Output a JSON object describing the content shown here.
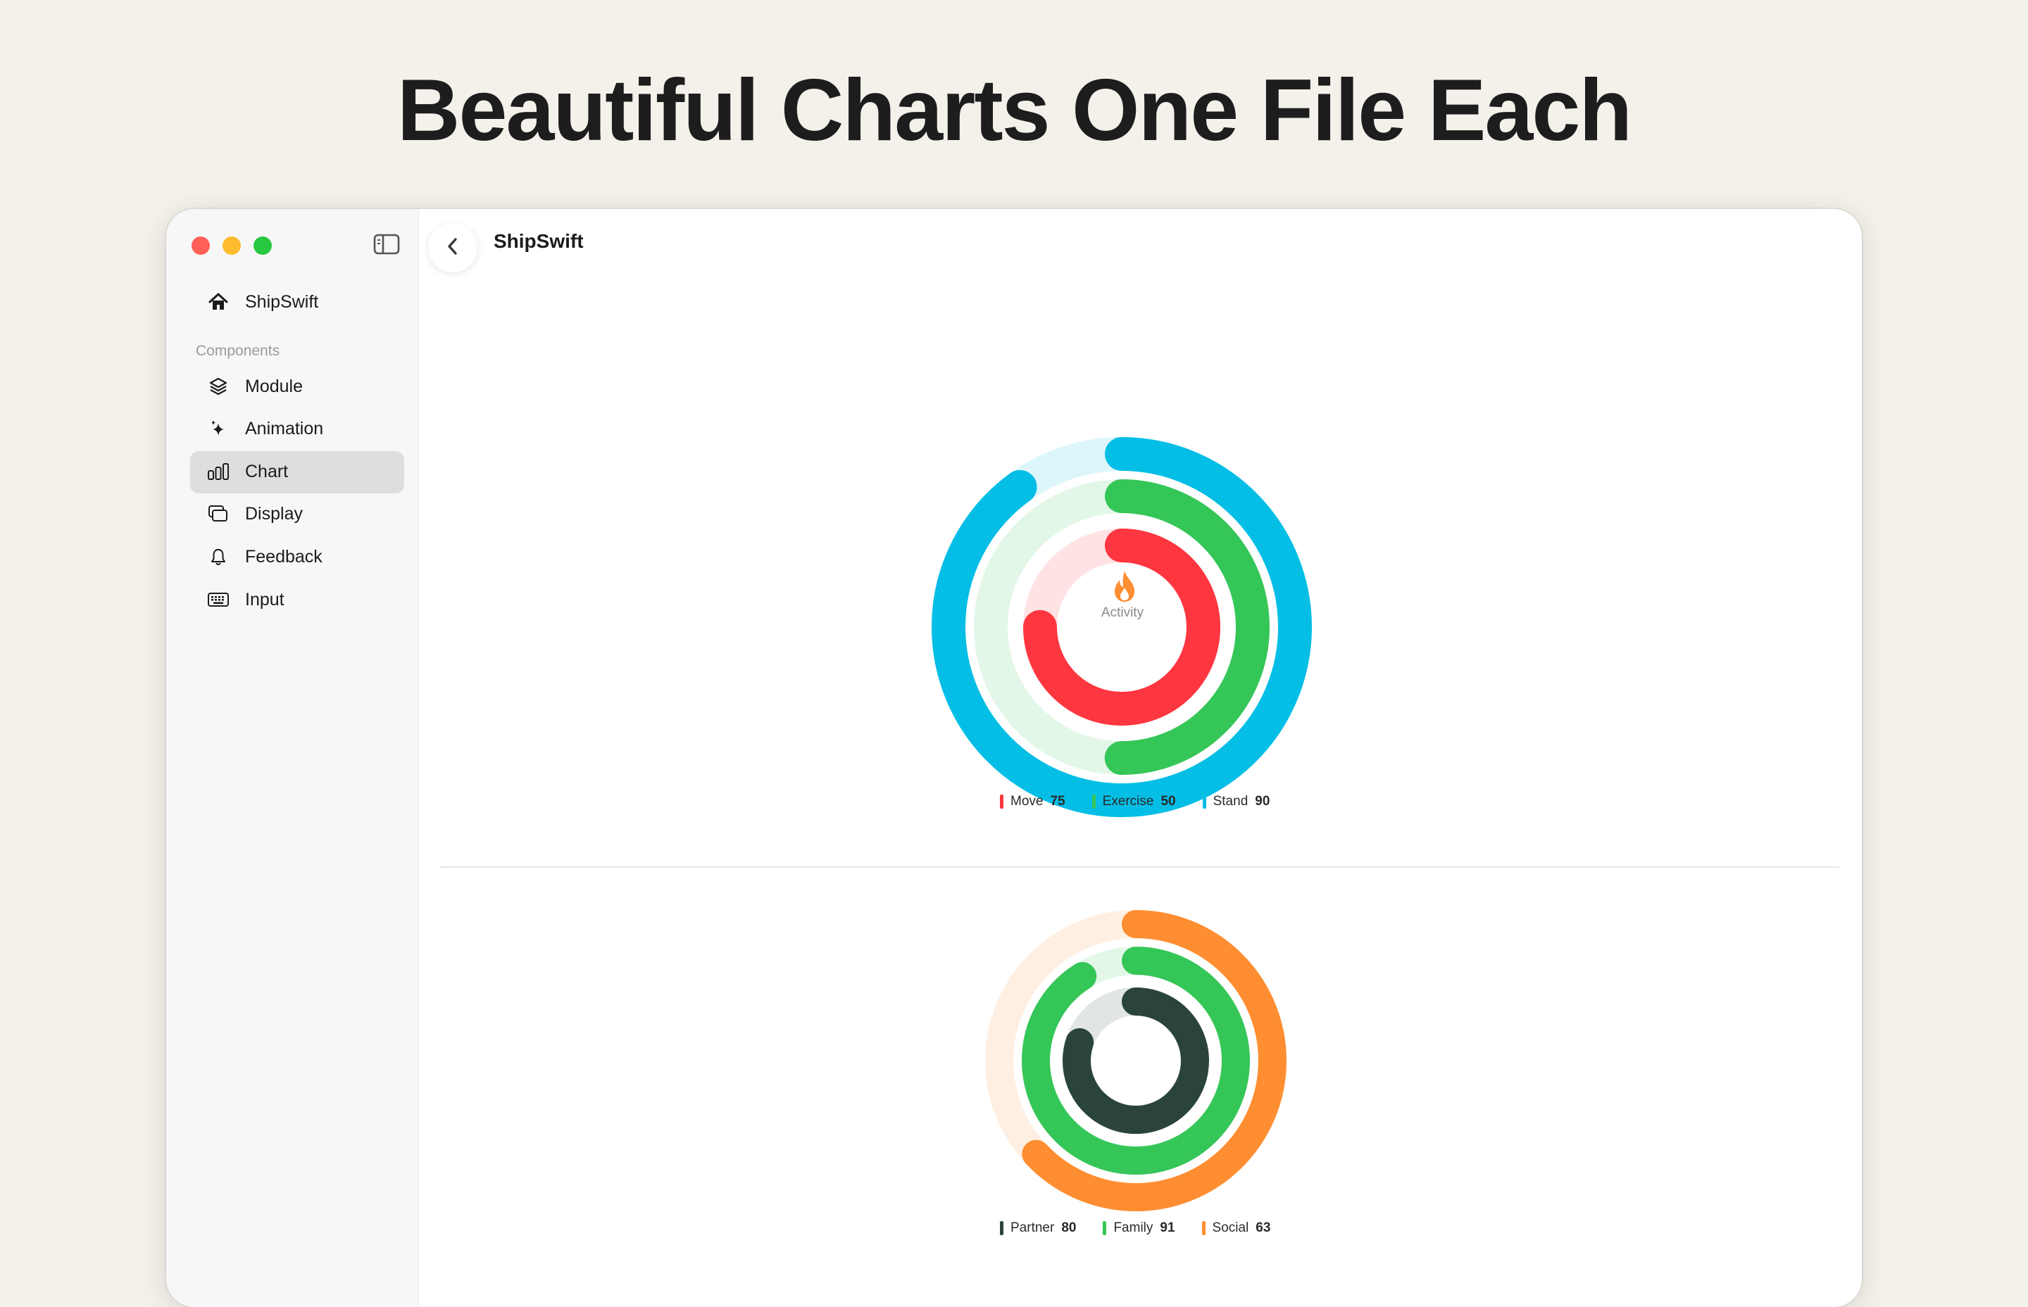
{
  "hero": {
    "title": "Beautiful Charts One File Each"
  },
  "sidebar": {
    "home_label": "ShipSwift",
    "section_label": "Components",
    "items": [
      {
        "label": "Module",
        "icon": "layers-icon"
      },
      {
        "label": "Animation",
        "icon": "sparkles-icon"
      },
      {
        "label": "Chart",
        "icon": "chart-icon",
        "selected": true
      },
      {
        "label": "Display",
        "icon": "display-icon"
      },
      {
        "label": "Feedback",
        "icon": "bell-icon"
      },
      {
        "label": "Input",
        "icon": "keyboard-icon"
      }
    ]
  },
  "header": {
    "title": "ShipSwift"
  },
  "chart_data": [
    {
      "type": "pie",
      "subtype": "activity-rings",
      "center_label": "Activity",
      "center_icon": "flame-icon",
      "series": [
        {
          "name": "Move",
          "value": 75,
          "color": "#fe363f"
        },
        {
          "name": "Exercise",
          "value": 50,
          "color": "#35c658"
        },
        {
          "name": "Stand",
          "value": 90,
          "color": "#04bee6"
        }
      ]
    },
    {
      "type": "pie",
      "subtype": "activity-rings",
      "series": [
        {
          "name": "Partner",
          "value": 80,
          "color": "#2a443c"
        },
        {
          "name": "Family",
          "value": 91,
          "color": "#35c658"
        },
        {
          "name": "Social",
          "value": 63,
          "color": "#fe8e31"
        }
      ]
    }
  ]
}
